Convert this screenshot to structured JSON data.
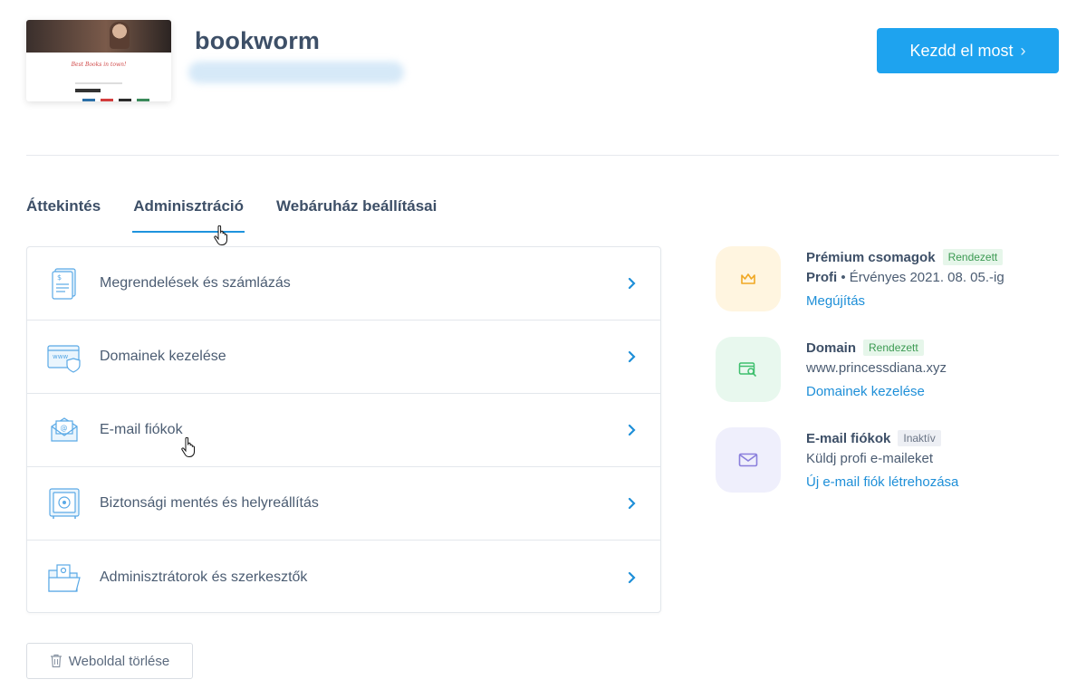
{
  "header": {
    "site_name": "bookworm",
    "thumbnail_headline": "Best Books in town!",
    "cta_label": "Kezdd el most",
    "cta_color": "#1ea3ef"
  },
  "tabs": [
    {
      "label": "Áttekintés",
      "active": false
    },
    {
      "label": "Adminisztráció",
      "active": true
    },
    {
      "label": "Webáruház beállításai",
      "active": false
    }
  ],
  "menu": [
    {
      "label": "Megrendelések és számlázás",
      "icon": "invoice-icon"
    },
    {
      "label": "Domainek kezelése",
      "icon": "domain-shield-icon"
    },
    {
      "label": "E-mail fiókok",
      "icon": "email-envelope-icon"
    },
    {
      "label": "Biztonsági mentés és helyreállítás",
      "icon": "safe-icon"
    },
    {
      "label": "Adminisztrátorok és szerkesztők",
      "icon": "admin-folder-icon"
    }
  ],
  "info": {
    "premium": {
      "title": "Prémium csomagok",
      "tag": "Rendezett",
      "plan": "Profi",
      "valid": " • Érvényes 2021. 08. 05.-ig",
      "link": "Megújítás",
      "icon": "crown-icon",
      "bg": "#fff5e0"
    },
    "domain": {
      "title": "Domain",
      "tag": "Rendezett",
      "value": "www.princessdiana.xyz",
      "link": "Domainek kezelése",
      "icon": "domain-search-icon",
      "bg": "#e8f8ee"
    },
    "email": {
      "title": "E-mail fiókok",
      "tag": "Inaktív",
      "value": "Küldj profi e-maileket",
      "link": "Új e-mail fiók létrehozása",
      "icon": "mail-icon",
      "bg": "#efeffc"
    }
  },
  "footer": {
    "delete_label": "Weboldal törlése"
  }
}
